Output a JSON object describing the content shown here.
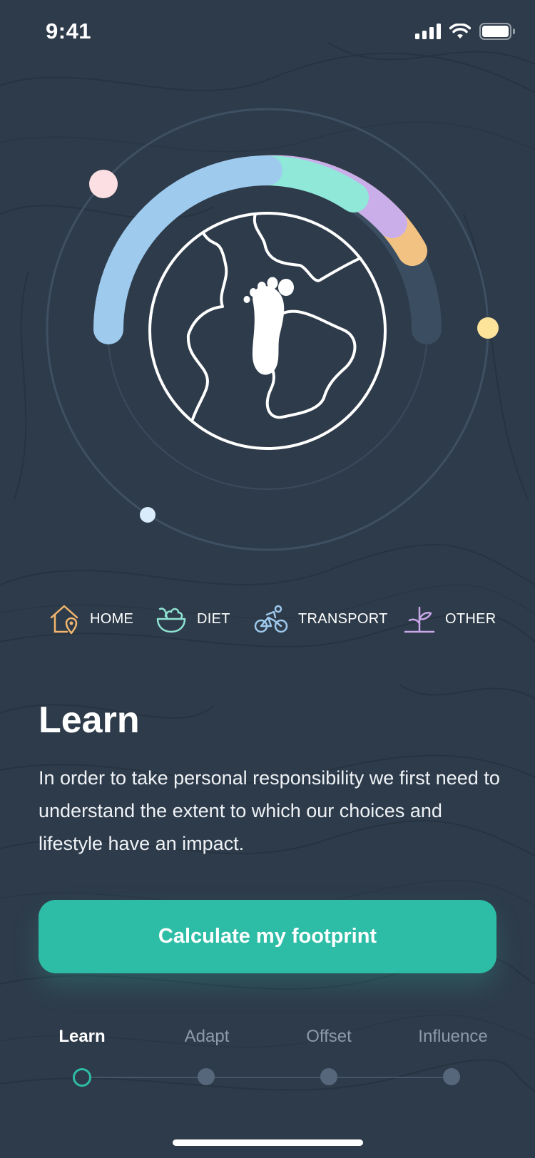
{
  "status_bar": {
    "time": "9:41"
  },
  "legend": {
    "items": [
      {
        "label": "HOME",
        "icon": "house-location-icon",
        "color": "#f2b66d"
      },
      {
        "label": "DIET",
        "icon": "salad-bowl-icon",
        "color": "#8fe3d3"
      },
      {
        "label": "TRANSPORT",
        "icon": "cyclist-icon",
        "color": "#9ec8ec"
      },
      {
        "label": "OTHER",
        "icon": "plant-sprout-icon",
        "color": "#c9a8ea"
      }
    ]
  },
  "content": {
    "title": "Learn",
    "body": "In order to take personal responsibility we first need to understand the extent to which our choices and lifestyle have an impact."
  },
  "cta": {
    "label": "Calculate my footprint"
  },
  "steps": {
    "items": [
      {
        "label": "Learn",
        "active": true
      },
      {
        "label": "Adapt",
        "active": false
      },
      {
        "label": "Offset",
        "active": false
      },
      {
        "label": "Influence",
        "active": false
      }
    ]
  },
  "colors": {
    "background": "#2e3b4a",
    "accent": "#2dbda6",
    "home": "#f2b66d",
    "diet": "#8fe3d3",
    "transport": "#9ec8ec",
    "other": "#c9a8ea"
  }
}
